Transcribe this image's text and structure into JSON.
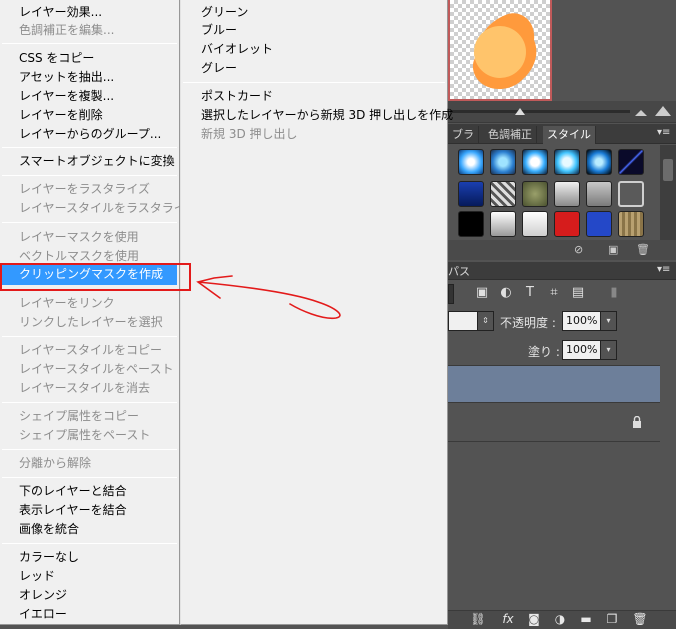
{
  "menu": {
    "items": [
      {
        "label": "レイヤー効果...",
        "enabled": true
      },
      {
        "label": "色調補正を編集...",
        "enabled": false
      },
      {
        "label": "CSS をコピー",
        "enabled": true
      },
      {
        "label": "アセットを抽出...",
        "enabled": true
      },
      {
        "label": "レイヤーを複製...",
        "enabled": true
      },
      {
        "label": "レイヤーを削除",
        "enabled": true
      },
      {
        "label": "レイヤーからのグループ...",
        "enabled": true
      },
      {
        "label": "スマートオブジェクトに変換",
        "enabled": true
      },
      {
        "label": "レイヤーをラスタライズ",
        "enabled": false
      },
      {
        "label": "レイヤースタイルをラスタライズ",
        "enabled": false
      },
      {
        "label": "レイヤーマスクを使用",
        "enabled": false
      },
      {
        "label": "ベクトルマスクを使用",
        "enabled": false
      },
      {
        "label": "クリッピングマスクを作成",
        "enabled": true,
        "selected": true
      },
      {
        "label": "レイヤーをリンク",
        "enabled": false
      },
      {
        "label": "リンクしたレイヤーを選択",
        "enabled": false
      },
      {
        "label": "レイヤースタイルをコピー",
        "enabled": false
      },
      {
        "label": "レイヤースタイルをペースト",
        "enabled": false
      },
      {
        "label": "レイヤースタイルを消去",
        "enabled": false
      },
      {
        "label": "シェイプ属性をコピー",
        "enabled": false
      },
      {
        "label": "シェイプ属性をペースト",
        "enabled": false
      },
      {
        "label": "分離から解除",
        "enabled": false
      },
      {
        "label": "下のレイヤーと結合",
        "enabled": true
      },
      {
        "label": "表示レイヤーを結合",
        "enabled": true
      },
      {
        "label": "画像を統合",
        "enabled": true
      },
      {
        "label": "カラーなし",
        "enabled": true
      },
      {
        "label": "レッド",
        "enabled": true
      },
      {
        "label": "オレンジ",
        "enabled": true
      },
      {
        "label": "イエロー",
        "enabled": true
      }
    ]
  },
  "submenu": {
    "items": [
      {
        "label": "グリーン",
        "enabled": true
      },
      {
        "label": "ブルー",
        "enabled": true
      },
      {
        "label": "バイオレット",
        "enabled": true
      },
      {
        "label": "グレー",
        "enabled": true
      },
      {
        "label": "ポストカード",
        "enabled": true
      },
      {
        "label": "選択したレイヤーから新規 3D 押し出しを作成",
        "enabled": true
      },
      {
        "label": "新規 3D 押し出し",
        "enabled": false
      }
    ]
  },
  "panels": {
    "tabs": [
      "ブラ",
      "色調補正",
      "スタイル"
    ],
    "active_tab": "スタイル",
    "layers_tab": "パス",
    "opacity_label": "不透明度 :",
    "opacity_value": "100%",
    "fill_label": "塗り :",
    "fill_value": "100%",
    "panel_menu_glyph": "▾≡"
  },
  "colors": {
    "menu_bg": "#f0f0f0",
    "highlight": "#3399ff",
    "annotation_red": "#e31a1a",
    "panel_bg": "#535353",
    "selected_layer": "#6d7f9a",
    "thumbnail_shape": "#ffc46b"
  }
}
